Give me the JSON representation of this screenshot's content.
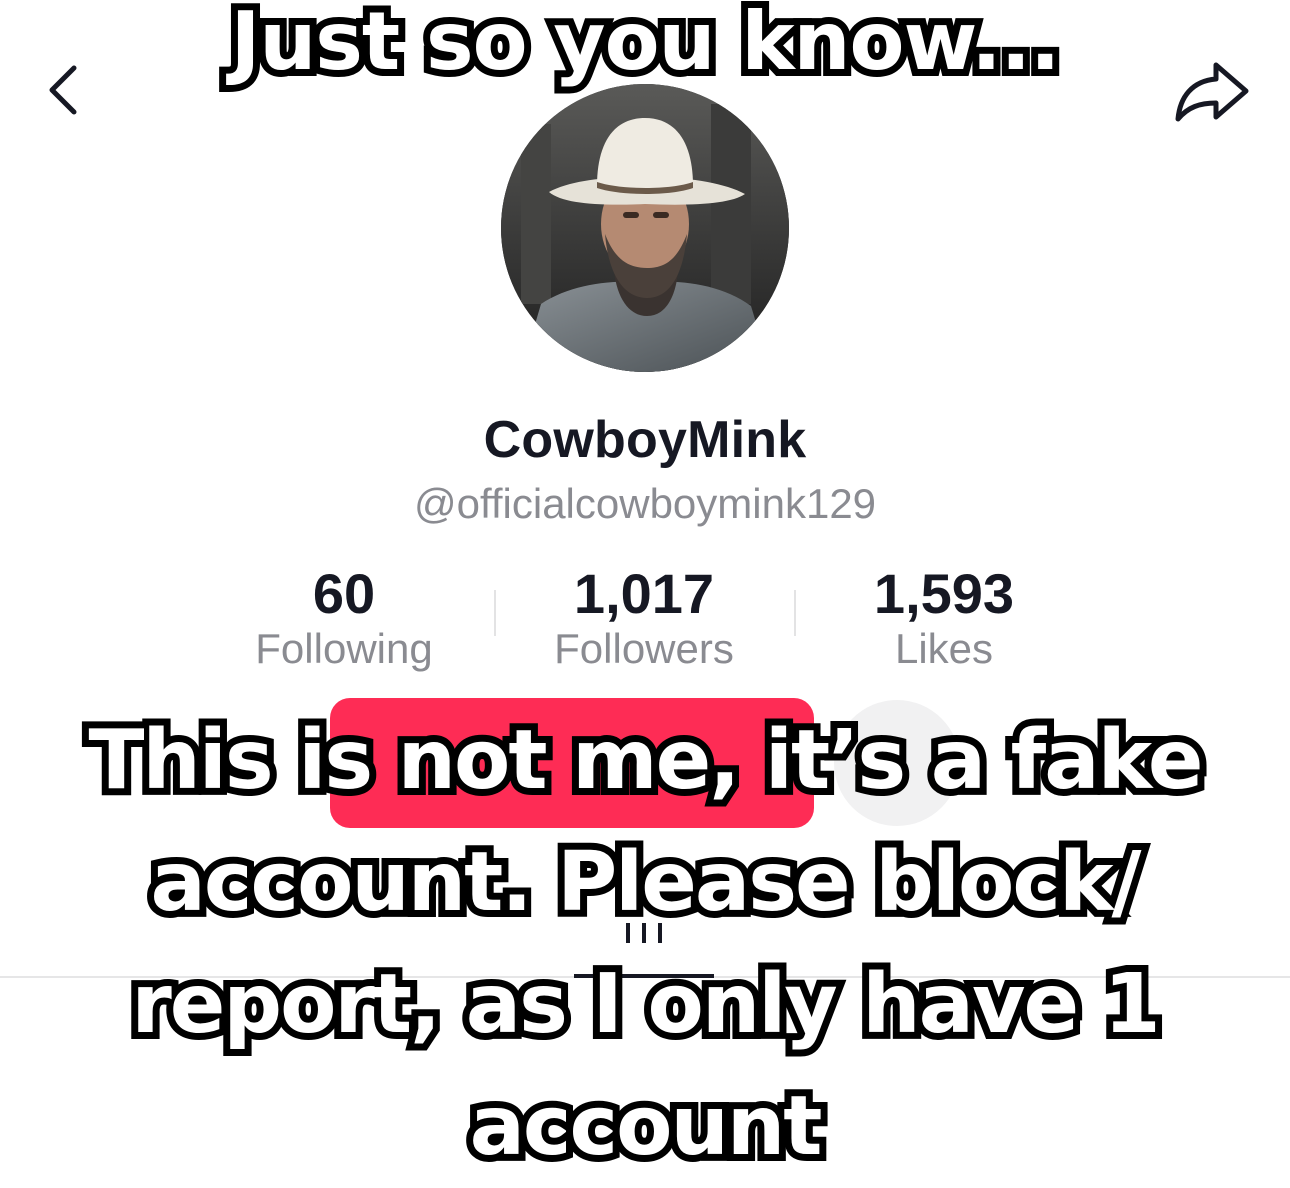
{
  "overlay": {
    "top_caption": "Just so you know...",
    "main_caption_lines": [
      "This is not me, it’s a fake",
      "account. Please block/",
      "report, as I only have 1",
      "account"
    ]
  },
  "profile": {
    "display_name": "CowboyMink",
    "handle": "@officialcowboymink129"
  },
  "stats": {
    "following": {
      "value": "60",
      "label": "Following"
    },
    "followers": {
      "value": "1,017",
      "label": "Followers"
    },
    "likes": {
      "value": "1,593",
      "label": "Likes"
    }
  },
  "actions": {
    "follow_label": "",
    "accent_color": "#fe2c55"
  },
  "icons": {
    "back": "chevron-left-icon",
    "share": "share-arrow-icon",
    "videos_tab": "grid-icon"
  },
  "colors": {
    "primary_text": "#161823",
    "secondary_text": "#8a8b91",
    "background": "#ffffff"
  }
}
